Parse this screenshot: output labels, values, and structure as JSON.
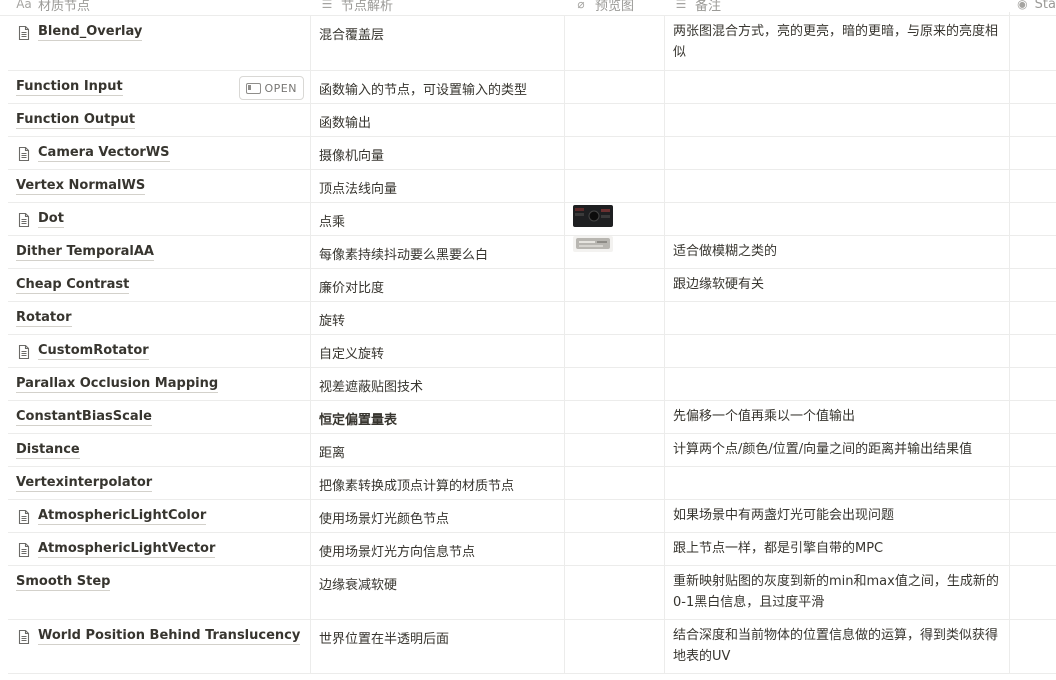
{
  "columns": {
    "name": "材质节点",
    "analysis": "节点解析",
    "preview": "预览图",
    "note": "备注",
    "status": "Sta"
  },
  "open_label": "OPEN",
  "rows": [
    {
      "name": "Blend_Overlay",
      "doc": true,
      "analysis": "混合覆盖层",
      "note": "两张图混合方式，亮的更亮，暗的更暗，与原来的亮度相似",
      "preview": ""
    },
    {
      "name": "Function Input",
      "doc": false,
      "analysis": "函数输入的节点，可设置输入的类型",
      "note": "",
      "preview": "",
      "open": true
    },
    {
      "name": "Function Output",
      "doc": false,
      "analysis": "函数输出",
      "note": "",
      "preview": ""
    },
    {
      "name": "Camera VectorWS",
      "doc": true,
      "analysis": "摄像机向量",
      "note": "",
      "preview": ""
    },
    {
      "name": "Vertex NormalWS",
      "doc": false,
      "analysis": "顶点法线向量",
      "note": "",
      "preview": ""
    },
    {
      "name": "Dot",
      "doc": true,
      "analysis": "点乘",
      "note": "",
      "preview": "dark-node-thumbnail"
    },
    {
      "name": "Dither TemporalAA",
      "doc": false,
      "analysis": "每像素持续抖动要么黑要么白",
      "note": "适合做模糊之类的",
      "preview": "gray-node-thumbnail"
    },
    {
      "name": "Cheap Contrast",
      "doc": false,
      "analysis": "廉价对比度",
      "note": "跟边缘软硬有关",
      "preview": ""
    },
    {
      "name": "Rotator",
      "doc": false,
      "analysis": "旋转",
      "note": "",
      "preview": ""
    },
    {
      "name": "CustomRotator",
      "doc": true,
      "analysis": "自定义旋转",
      "note": "",
      "preview": ""
    },
    {
      "name": "Parallax Occlusion Mapping",
      "doc": false,
      "analysis": "视差遮蔽贴图技术",
      "note": "",
      "preview": ""
    },
    {
      "name": "ConstantBiasScale",
      "doc": false,
      "analysis": "恒定偏置量表",
      "note": "先偏移一个值再乘以一个值输出",
      "preview": "",
      "bold": true
    },
    {
      "name": "Distance",
      "doc": false,
      "analysis": "距离",
      "note": "计算两个点/颜色/位置/向量之间的距离并输出结果值",
      "preview": ""
    },
    {
      "name": "Vertexinterpolator",
      "doc": false,
      "analysis": "把像素转换成顶点计算的材质节点",
      "note": "",
      "preview": ""
    },
    {
      "name": "AtmosphericLightColor",
      "doc": true,
      "analysis": "使用场景灯光颜色节点",
      "note": "如果场景中有两盏灯光可能会出现问题",
      "preview": ""
    },
    {
      "name": "AtmosphericLightVector",
      "doc": true,
      "analysis": "使用场景灯光方向信息节点",
      "note": "跟上节点一样，都是引擎自带的MPC",
      "preview": ""
    },
    {
      "name": "Smooth Step",
      "doc": false,
      "analysis": "边缘衰减软硬",
      "note": "重新映射贴图的灰度到新的min和max值之间，生成新的0-1黑白信息，且过度平滑",
      "preview": ""
    },
    {
      "name": "World Position Behind Translucency",
      "doc": true,
      "analysis": "世界位置在半透明后面",
      "note": "结合深度和当前物体的位置信息做的运算，得到类似获得地表的UV",
      "preview": ""
    }
  ]
}
